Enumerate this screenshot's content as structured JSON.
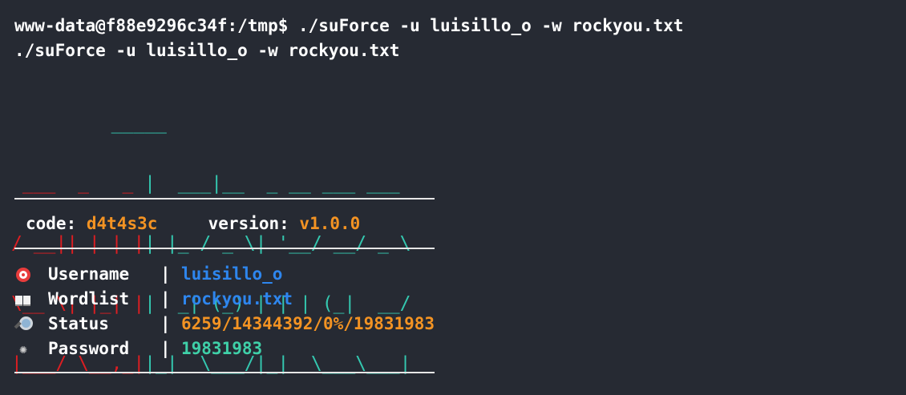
{
  "terminal": {
    "prompt_line": "www-data@f88e9296c34f:/tmp$ ./suForce -u luisillo_o -w rockyou.txt",
    "echo_line": "./suForce -u luisillo_o -w rockyou.txt"
  },
  "banner": {
    "logo_red_lines": [
      "",
      "",
      " ___  _   _ ",
      "/ __|| | | |",
      "\\__ \\| |_| |",
      "|___/ \\__,_|"
    ],
    "logo_teal_lines": [
      "      _____",
      "     |  ___|__  _ __ ___ ___",
      "     | |_ / _ \\| '__/ __/ _ \\",
      "     |  _| (_) | | | (_|  __/",
      "     |_|  \\___/|_|  \\___\\___|",
      ""
    ],
    "logo_text": "suForce"
  },
  "meta": {
    "code_label": "code:",
    "code_value": "d4t4s3c",
    "version_label": "version:",
    "version_value": "v1.0.0"
  },
  "fields": [
    {
      "icon": "target-icon",
      "name": "Username",
      "sep": "|",
      "value": "luisillo_o",
      "color": "#2e86ee"
    },
    {
      "icon": "book-icon",
      "name": "Wordlist",
      "sep": "|",
      "value": "rockyou.txt",
      "color": "#2e86ee"
    },
    {
      "icon": "magnifier-icon",
      "name": "Status",
      "sep": "|",
      "value": "6259/14344392/0%/19831983",
      "color": "#f39323"
    },
    {
      "icon": "burst-icon",
      "name": "Password",
      "sep": "|",
      "value": "19831983",
      "color": "#3fd0a8"
    }
  ],
  "colors": {
    "background": "#262a33",
    "logo_red": "#dd1e22",
    "logo_teal": "#34c8b0",
    "accent_orange": "#f39323",
    "accent_blue": "#2e86ee",
    "accent_green": "#3fd0a8"
  }
}
